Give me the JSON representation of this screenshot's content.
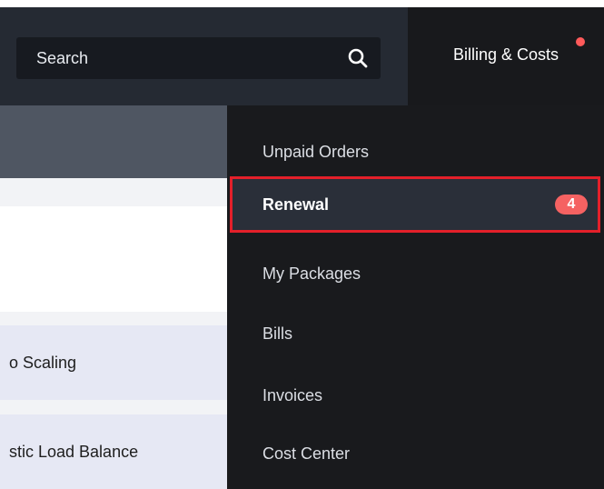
{
  "header": {
    "search_placeholder": "Search",
    "billing_label": "Billing & Costs"
  },
  "services": [
    {
      "label": "o Scaling"
    },
    {
      "label": "stic Load Balance"
    }
  ],
  "billing_menu": {
    "items": [
      {
        "label": "Unpaid Orders"
      },
      {
        "label": "Renewal",
        "badge": "4",
        "selected": true
      },
      {
        "label": "My Packages"
      },
      {
        "label": "Bills"
      },
      {
        "label": "Invoices"
      },
      {
        "label": "Cost Center"
      }
    ]
  },
  "colors": {
    "header_bg": "#252a33",
    "menu_bg": "#191a1d",
    "highlight_border": "#e3202a",
    "badge_bg": "#f56262"
  }
}
